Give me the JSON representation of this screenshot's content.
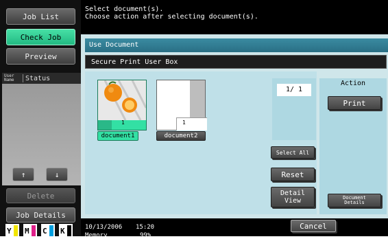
{
  "sidebar": {
    "job_list": "Job List",
    "check_job": "Check Job",
    "preview": "Preview",
    "col_user_name": "User Name",
    "col_status": "Status",
    "delete": "Delete",
    "job_details": "Job Details",
    "arrow_up": "↑",
    "arrow_down": "↓",
    "toners": [
      {
        "label": "Y",
        "color": "#f2e600"
      },
      {
        "label": "M",
        "color": "#e0208a"
      },
      {
        "label": "C",
        "color": "#00a0e0"
      },
      {
        "label": "K",
        "color": "#000000"
      }
    ]
  },
  "message": {
    "line1": "Select document(s).",
    "line2": "Choose action after selecting document(s)."
  },
  "window": {
    "title": "Use Document",
    "box_name": "Secure Print User Box"
  },
  "documents": [
    {
      "name": "document1",
      "page_number": "1",
      "selected": true
    },
    {
      "name": "document2",
      "page_number": "1",
      "selected": false
    }
  ],
  "pager": {
    "text": "1/  1"
  },
  "buttons": {
    "select_all": "Select All",
    "reset": "Reset",
    "detail_view_line1": "Detail",
    "detail_view_line2": "View"
  },
  "action": {
    "title": "Action",
    "print": "Print",
    "document_details_line1": "Document",
    "document_details_line2": "Details"
  },
  "footer": {
    "date": "10/13/2006",
    "time": "15:20",
    "memory_label": "Memory",
    "memory_value": "99%",
    "cancel": "Cancel"
  }
}
